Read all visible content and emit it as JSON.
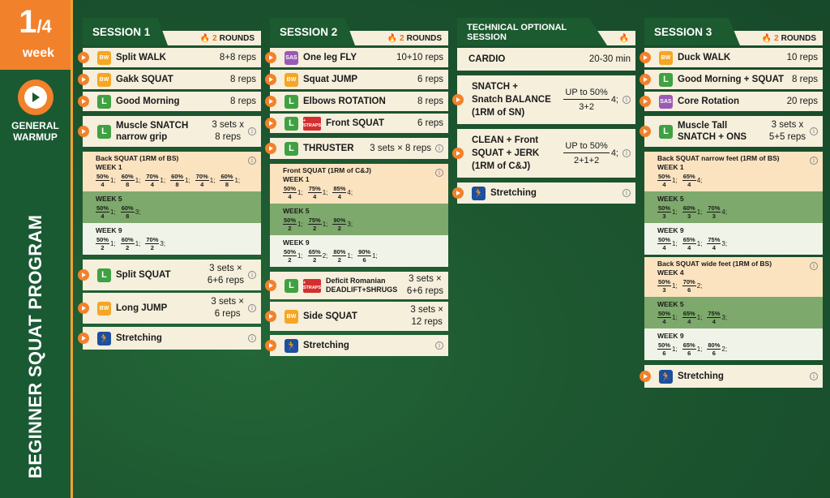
{
  "program": {
    "week_num": "1",
    "week_total": "/4",
    "week_label": "week",
    "warmup_label_1": "GENERAL",
    "warmup_label_2": "WARMUP",
    "title": "BEGINNER SQUAT PROGRAM"
  },
  "s1": {
    "title": "SESSION 1",
    "rounds_n": "2",
    "rounds_l": "ROUNDS",
    "ex": [
      {
        "tag": "BW",
        "name": "Split WALK",
        "val": "8+8 reps"
      },
      {
        "tag": "BW",
        "name": "Gakk SQUAT",
        "val": "8 reps"
      },
      {
        "tag": "L",
        "name": "Good Morning",
        "val": "8 reps"
      }
    ],
    "snatch": {
      "tag": "L",
      "name1": "Muscle SNATCH",
      "name2": "narrow grip",
      "v1": "3 sets x",
      "v2": "8 reps"
    },
    "bs": {
      "title": "Back SQUAT (1RM of BS)",
      "w1": "WEEK 1",
      "w1f": [
        [
          "50%",
          "4",
          "1;"
        ],
        [
          "60%",
          "8",
          "1;"
        ],
        [
          "70%",
          "4",
          "1;"
        ],
        [
          "60%",
          "8",
          "1;"
        ],
        [
          "70%",
          "4",
          "1;"
        ],
        [
          "60%",
          "8",
          "1;"
        ]
      ],
      "w5": "WEEK 5",
      "w5f": [
        [
          "50%",
          "4",
          "1;"
        ],
        [
          "60%",
          "8",
          "3;"
        ]
      ],
      "w9": "WEEK 9",
      "w9f": [
        [
          "50%",
          "2",
          "1;"
        ],
        [
          "60%",
          "2",
          "1;"
        ],
        [
          "70%",
          "2",
          "3;"
        ]
      ]
    },
    "split": {
      "tag": "L",
      "name": "Split SQUAT",
      "v1": "3 sets ×",
      "v2": "6+6 reps"
    },
    "jump": {
      "tag": "BW",
      "name": "Long JUMP",
      "v1": "3 sets ×",
      "v2": "6 reps"
    },
    "stretch": "Stretching"
  },
  "s2": {
    "title": "SESSION 2",
    "rounds_n": "2",
    "rounds_l": "ROUNDS",
    "ex": [
      {
        "tag": "SAS",
        "name": "One leg FLY",
        "val": "10+10 reps"
      },
      {
        "tag": "BW",
        "name": "Squat JUMP",
        "val": "6 reps"
      },
      {
        "tag": "L",
        "name": "Elbows ROTATION",
        "val": "8 reps"
      }
    ],
    "front": {
      "tag": "L",
      "straps": "+ STRAPS",
      "name": "Front SQUAT",
      "val": "6 reps"
    },
    "thruster": {
      "tag": "L",
      "name": "THRUSTER",
      "val": "3 sets × 8 reps"
    },
    "fs": {
      "title": "Front SQUAT (1RM of C&J)",
      "w1": "WEEK 1",
      "w1f": [
        [
          "50%",
          "4",
          "1;"
        ],
        [
          "75%",
          "4",
          "1;"
        ],
        [
          "85%",
          "4",
          "4;"
        ]
      ],
      "w5": "WEEK 5",
      "w5f": [
        [
          "50%",
          "2",
          "1;"
        ],
        [
          "75%",
          "2",
          "1;"
        ],
        [
          "90%",
          "2",
          "3;"
        ]
      ],
      "w9": "WEEK 9",
      "w9f": [
        [
          "50%",
          "2",
          "1;"
        ],
        [
          "65%",
          "2",
          "2;"
        ],
        [
          "80%",
          "2",
          "1;"
        ],
        [
          "90%",
          "6",
          "1;"
        ]
      ]
    },
    "deficit": {
      "tag": "L",
      "straps": "+ STRAPS",
      "name1": "Deficit Romanian",
      "name2": "DEADLIFT+SHRUGS",
      "v1": "3 sets ×",
      "v2": "6+6 reps"
    },
    "side": {
      "tag": "BW",
      "name": "Side SQUAT",
      "v1": "3 sets ×",
      "v2": "12 reps"
    },
    "stretch": "Stretching"
  },
  "t": {
    "title1": "TECHNICAL OPTIONAL",
    "title2": "SESSION",
    "cardio": {
      "name": "CARDIO",
      "val": "20-30 min"
    },
    "snb": {
      "n1": "SNATCH +",
      "n2": "Snatch BALANCE",
      "n3": "(1RM of SN)",
      "top": "UP to 50%",
      "bot": "3+2",
      "suf": "4;"
    },
    "cj": {
      "n1": "CLEAN + Front",
      "n2": "SQUAT + JERK",
      "n3": "(1RM of C&J)",
      "top": "UP to 50%",
      "bot": "2+1+2",
      "suf": "4;"
    },
    "stretch": "Stretching"
  },
  "s3": {
    "title": "SESSION 3",
    "rounds_n": "2",
    "rounds_l": "ROUNDS",
    "ex": [
      {
        "tag": "BW",
        "name": "Duck WALK",
        "val": "10 reps"
      },
      {
        "tag": "L",
        "name": "Good Morning + SQUAT",
        "val": "8 reps"
      },
      {
        "tag": "SAS",
        "name": "Core Rotation",
        "val": "20 reps"
      }
    ],
    "tall": {
      "tag": "L",
      "name1": "Muscle Tall",
      "name2": "SNATCH + ONS",
      "v1": "3 sets x",
      "v2": "5+5 reps"
    },
    "bsn": {
      "title": "Back SQUAT narrow feet (1RM of BS)",
      "w1": "WEEK 1",
      "w1f": [
        [
          "50%",
          "4",
          "1;"
        ],
        [
          "65%",
          "4",
          "4;"
        ]
      ],
      "w5": "WEEK 5",
      "w5f": [
        [
          "50%",
          "3",
          "1;"
        ],
        [
          "60%",
          "3",
          "1;"
        ],
        [
          "70%",
          "3",
          "4;"
        ]
      ],
      "w9": "WEEK 9",
      "w9f": [
        [
          "50%",
          "4",
          "1;"
        ],
        [
          "65%",
          "4",
          "1;"
        ],
        [
          "75%",
          "4",
          "3;"
        ]
      ]
    },
    "bsw": {
      "title": "Back SQUAT wide feet (1RM of BS)",
      "w4": "WEEK 4",
      "w4f": [
        [
          "50%",
          "3",
          "1;"
        ],
        [
          "70%",
          "6",
          "2;"
        ]
      ],
      "w5": "WEEK 5",
      "w5f": [
        [
          "50%",
          "4",
          "1;"
        ],
        [
          "65%",
          "4",
          "1;"
        ],
        [
          "75%",
          "4",
          "3;"
        ]
      ],
      "w9": "WEEK 9",
      "w9f": [
        [
          "50%",
          "6",
          "1;"
        ],
        [
          "65%",
          "6",
          "1;"
        ],
        [
          "80%",
          "6",
          "2;"
        ]
      ]
    },
    "stretch": "Stretching"
  }
}
